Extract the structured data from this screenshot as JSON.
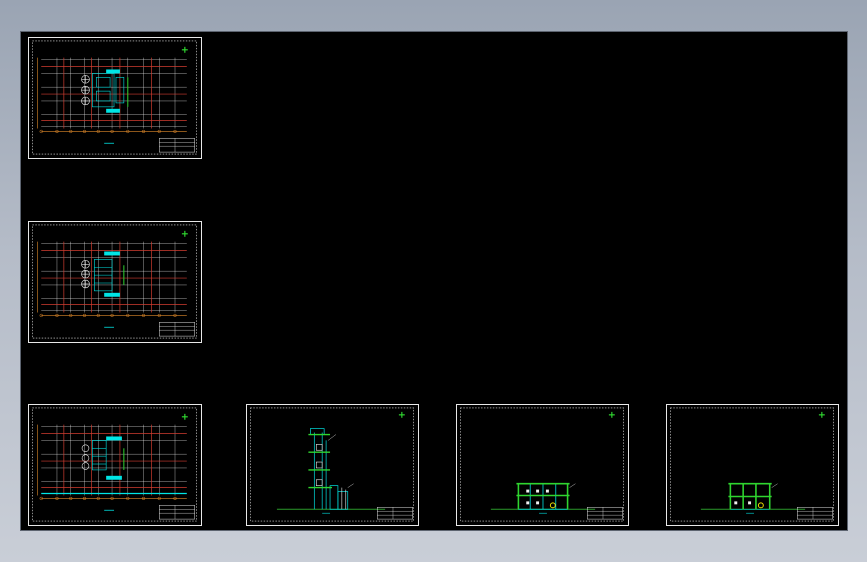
{
  "colors": {
    "background": "#000000",
    "border": "#e8e8e8",
    "grid_red": "#d23c30",
    "grid_white": "#f0f0f0",
    "equipment_cyan": "#00e5e5",
    "section_green": "#2fd52f",
    "ground_green": "#2a9a2a",
    "marker_yellow": "#f0e000",
    "dim_orange": "#e08a2a"
  },
  "icons": {
    "north_arrow": "north-arrow-icon"
  },
  "sheets": [
    {
      "id": "plan-1",
      "kind": "plan"
    },
    {
      "id": "plan-2",
      "kind": "plan"
    },
    {
      "id": "plan-3",
      "kind": "plan"
    },
    {
      "id": "section-1",
      "kind": "tower-section"
    },
    {
      "id": "section-2",
      "kind": "frame-section"
    },
    {
      "id": "section-3",
      "kind": "frame-section"
    }
  ]
}
